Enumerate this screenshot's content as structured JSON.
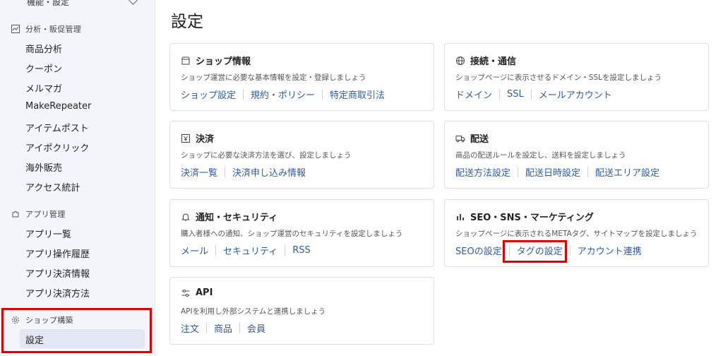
{
  "sidebar": {
    "top_label": "機能・設定",
    "groups": [
      {
        "label": "分析・販促管理",
        "icon": "chart-icon",
        "items": [
          "商品分析",
          "クーポン",
          "メルマガ",
          "MakeRepeater",
          "アイテムポスト",
          "アイポクリック",
          "海外販売",
          "アクセス統計"
        ]
      },
      {
        "label": "アプリ管理",
        "icon": "puzzle-icon",
        "items": [
          "アプリ一覧",
          "アプリ操作履歴",
          "アプリ決済情報",
          "アプリ決済方法"
        ]
      },
      {
        "label": "ショップ構築",
        "icon": "gear-icon",
        "items": [
          "設定"
        ]
      }
    ]
  },
  "main": {
    "title": "設定",
    "cards": [
      {
        "title": "ショップ情報",
        "icon": "shop-icon",
        "desc": "ショップ運営に必要な基本情報を設定・登録しましょう",
        "links": [
          "ショップ設定",
          "規約・ポリシー",
          "特定商取引法"
        ]
      },
      {
        "title": "接続・通信",
        "icon": "globe-icon",
        "desc": "ショップページに表示させるドメイン・SSLを設定しましょう",
        "links": [
          "ドメイン",
          "SSL",
          "メールアカウント"
        ]
      },
      {
        "title": "決済",
        "icon": "yen-icon",
        "desc": "ショップに必要な決済方法を選び、設定しましょう",
        "links": [
          "決済一覧",
          "決済申し込み情報"
        ]
      },
      {
        "title": "配送",
        "icon": "truck-icon",
        "desc": "商品の配送ルールを設定し、送料を設定しましょう",
        "links": [
          "配送方法設定",
          "配送日時設定",
          "配送エリア設定"
        ]
      },
      {
        "title": "通知・セキュリティ",
        "icon": "bell-icon",
        "desc": "購入者様への通知、ショップ運営のセキュリティを設定しましょう",
        "links": [
          "メール",
          "セキュリティ",
          "RSS"
        ]
      },
      {
        "title": "SEO・SNS・マーケティング",
        "icon": "bar-chart-icon",
        "desc": "ショップページに表示されるMETAタグ、サイトマップを設定しましょう",
        "links": [
          "SEOの設定",
          "タグの設定",
          "アカウント連携"
        ]
      },
      {
        "title": "API",
        "icon": "api-icon",
        "desc": "APIを利用し外部システムと連携しましょう",
        "links": [
          "注文",
          "商品",
          "会員"
        ]
      }
    ]
  },
  "colors": {
    "link": "#2e5aa8",
    "highlight": "#e00000",
    "sidebar_bg": "#f4f5fa"
  }
}
